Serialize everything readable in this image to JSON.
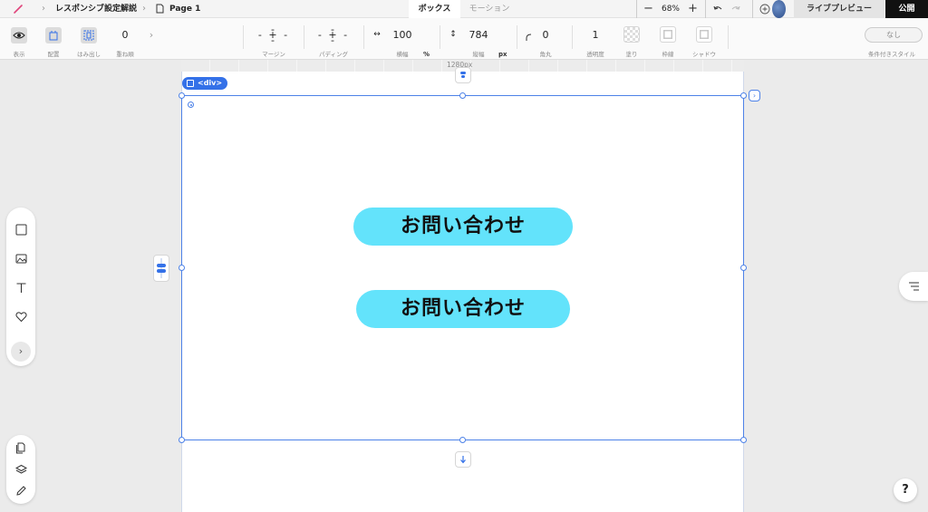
{
  "topbar": {
    "breadcrumbs": [
      "レスポンシブ設定解説",
      "Page 1"
    ],
    "tabs": [
      {
        "label": "ボックス",
        "active": true
      },
      {
        "label": "モーション",
        "active": false
      }
    ],
    "zoom": "68%",
    "live_preview_label": "ライブプレビュー",
    "publish_label": "公開"
  },
  "toolbar": {
    "display_caption": "表示",
    "layout_caption": "配置",
    "overflow_caption": "はみ出し",
    "zindex_value": "0",
    "zindex_caption": "重ね順",
    "margin_caption": "マージン",
    "padding_caption": "パディング",
    "width_value": "100",
    "width_unit": "%",
    "width_caption": "横幅",
    "height_value": "784",
    "height_unit": "px",
    "height_caption": "縦幅",
    "radius_value": "0",
    "radius_caption": "角丸",
    "opacity_value": "1",
    "opacity_caption": "透明度",
    "fill_caption": "塗り",
    "border_caption": "枠線",
    "shadow_caption": "シャドウ",
    "conditional_value": "なし",
    "conditional_caption": "条件付きスタイル"
  },
  "canvas": {
    "ruler_label": "1280px",
    "selection_tag": "<div>",
    "buttons": [
      "お問い合わせ",
      "お問い合わせ"
    ]
  },
  "colors": {
    "accent": "#3471e8",
    "cta": "#63e3fb",
    "publish_bg": "#111111"
  },
  "help_label": "?"
}
